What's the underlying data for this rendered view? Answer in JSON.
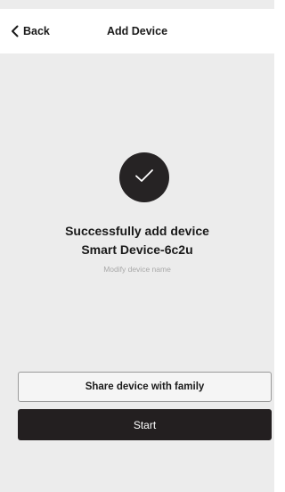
{
  "nav": {
    "back_label": "Back",
    "title": "Add Device"
  },
  "result": {
    "icon": "checkmark-icon",
    "message": "Successfully add device",
    "device_name": "Smart Device-6c2u",
    "modify_link": "Modify device name"
  },
  "actions": {
    "share_label": "Share device with family",
    "start_label": "Start"
  },
  "colors": {
    "background": "#ececec",
    "nav_background": "#ffffff",
    "icon_circle": "#262324",
    "primary_button": "#231f20",
    "secondary_button": "#f5f5f5",
    "muted_text": "#a9a9a9"
  }
}
